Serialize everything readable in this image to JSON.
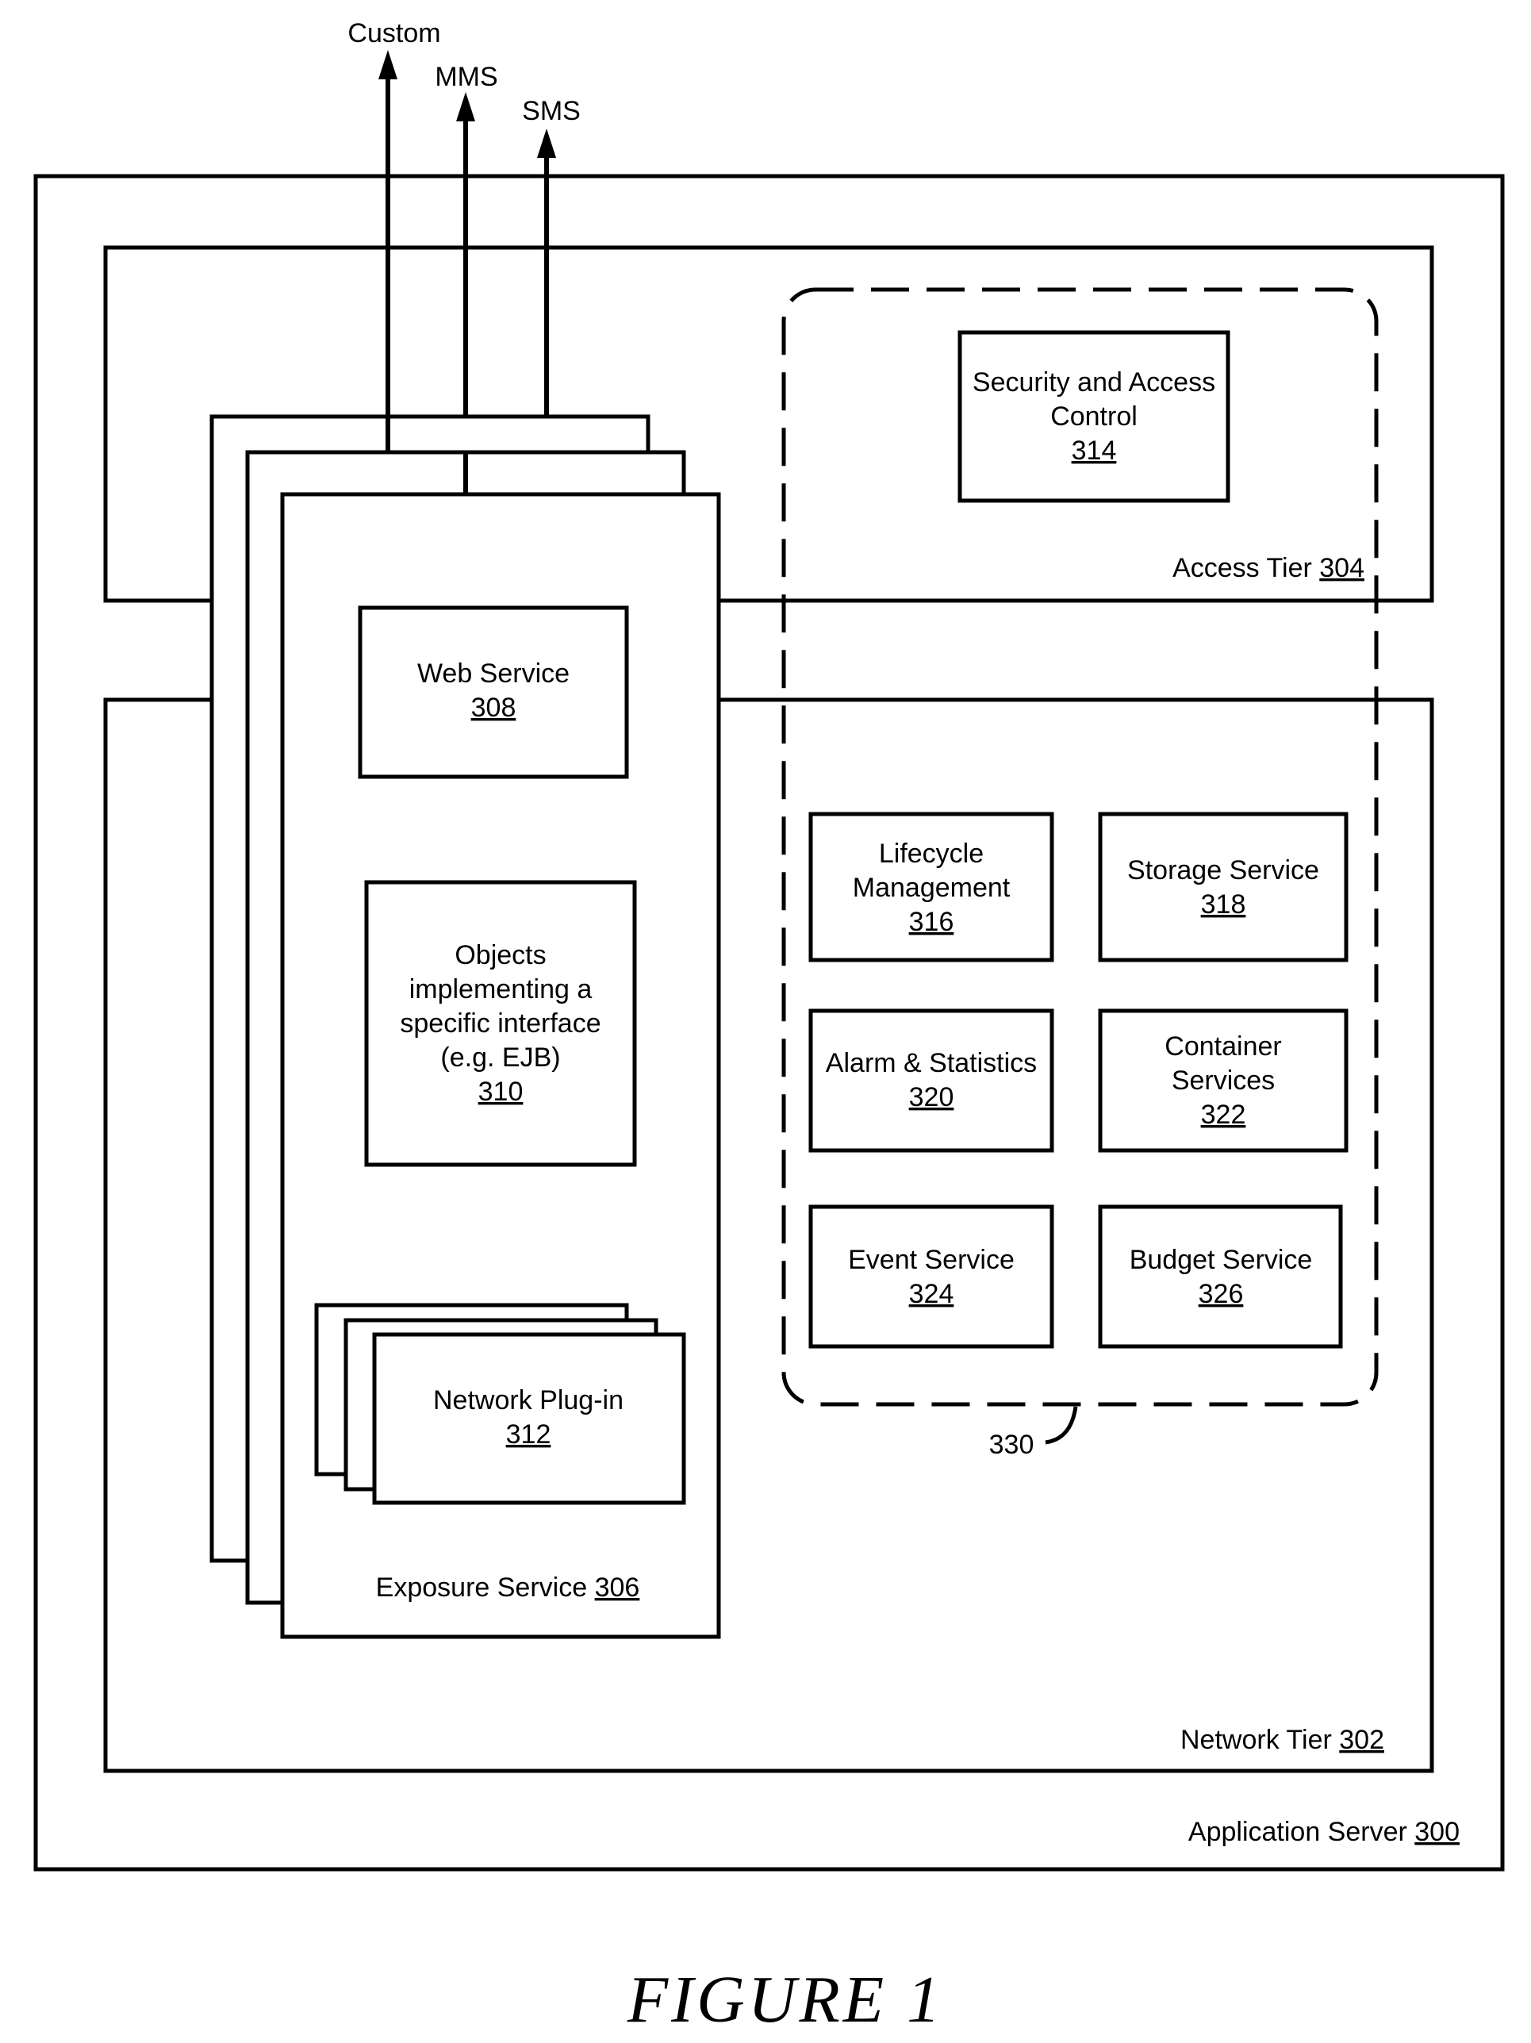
{
  "figure": {
    "caption": "FIGURE 1"
  },
  "outputs": [
    {
      "label": "Custom"
    },
    {
      "label": "MMS"
    },
    {
      "label": "SMS"
    }
  ],
  "application_server": {
    "label": "Application Server ",
    "ref": "300"
  },
  "access_tier": {
    "label": "Access Tier ",
    "ref": "304"
  },
  "network_tier": {
    "label": "Network Tier ",
    "ref": "302"
  },
  "exposure_service": {
    "label": "Exposure Service ",
    "ref": "306",
    "web_service": {
      "lines": [
        "Web Service"
      ],
      "ref": "308"
    },
    "objects": {
      "lines": [
        "Objects",
        "implementing a",
        "specific interface",
        "(e.g. EJB)"
      ],
      "ref": "310"
    },
    "network_plugin": {
      "lines": [
        "Network Plug-in"
      ],
      "ref": "312"
    }
  },
  "security": {
    "lines": [
      "Security and Access",
      "Control"
    ],
    "ref": "314"
  },
  "services_group": {
    "ref": "330"
  },
  "services": [
    {
      "lines": [
        "Lifecycle",
        "Management"
      ],
      "ref": "316"
    },
    {
      "lines": [
        "Storage Service"
      ],
      "ref": "318"
    },
    {
      "lines": [
        "Alarm & Statistics"
      ],
      "ref": "320"
    },
    {
      "lines": [
        "Container",
        "Services"
      ],
      "ref": "322"
    },
    {
      "lines": [
        "Event Service"
      ],
      "ref": "324"
    },
    {
      "lines": [
        "Budget Service"
      ],
      "ref": "326"
    }
  ]
}
